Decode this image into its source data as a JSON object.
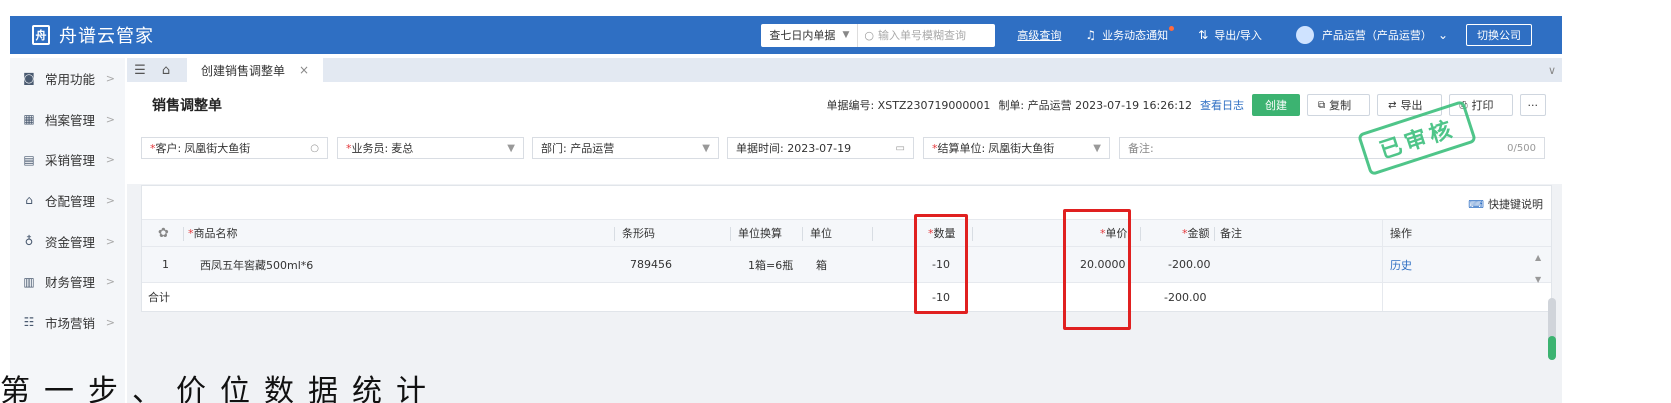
{
  "header": {
    "app_name": "舟谱云管家",
    "logo_glyph": "舟",
    "range_select": "查七日内单据",
    "search_placeholder": "输入单号模糊查询",
    "advanced_search": "高级查询",
    "notifications": "业务动态通知",
    "export_import": "导出/导入",
    "user": "产品运营（产品运营）",
    "switch_company": "切换公司"
  },
  "sidebar": {
    "items": [
      {
        "label": "常用功能",
        "icon": "common-icon"
      },
      {
        "label": "档案管理",
        "icon": "archive-icon"
      },
      {
        "label": "采销管理",
        "icon": "purchase-icon"
      },
      {
        "label": "仓配管理",
        "icon": "warehouse-icon"
      },
      {
        "label": "资金管理",
        "icon": "fund-icon"
      },
      {
        "label": "财务管理",
        "icon": "finance-icon"
      },
      {
        "label": "市场营销",
        "icon": "marketing-icon"
      }
    ]
  },
  "tabs": {
    "active": "创建销售调整单"
  },
  "document": {
    "title": "销售调整单",
    "doc_no": "单据编号: XSTZ230719000001",
    "creator": "制单: 产品运营 2023-07-19 16:26:12",
    "view_log": "查看日志",
    "btn_create": "创建",
    "btn_copy": "复制",
    "btn_export": "导出",
    "btn_print": "打印",
    "btn_more": "···",
    "stamp": "已审核"
  },
  "form": {
    "customer_label": "客户:",
    "customer_value": "凤凰街大鱼街",
    "salesman_label": "业务员:",
    "salesman_value": "麦总",
    "department": "部门: 产品运营",
    "doc_date": "单据时间: 2023-07-19",
    "settlement_label": "结算单位:",
    "settlement_value": "凤凰街大鱼街",
    "remark": "备注:",
    "remark_count": "0/500"
  },
  "table": {
    "shortcut": "快捷键说明",
    "columns": {
      "name": "商品名称",
      "barcode": "条形码",
      "unit_conv": "单位换算",
      "unit": "单位",
      "qty": "数量",
      "price": "单价",
      "amount": "金额",
      "note": "备注",
      "ops": "操作"
    },
    "rows": [
      {
        "index": "1",
        "name": "西凤五年窖藏500ml*6",
        "barcode": "789456",
        "unit_conv": "1箱=6瓶",
        "unit": "箱",
        "qty": "-10",
        "price": "20.0000",
        "amount": "-200.00",
        "op": "历史"
      }
    ],
    "total_label": "合计",
    "total_qty": "-10",
    "total_amount": "-200.00"
  },
  "caption": "第一步、价位数据统计"
}
